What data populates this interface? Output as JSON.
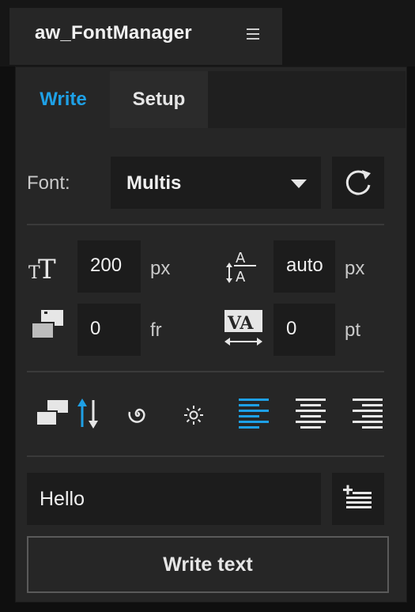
{
  "panel": {
    "title": "aw_FontManager"
  },
  "tabs": [
    {
      "label": "Write",
      "active": true
    },
    {
      "label": "Setup",
      "active": false
    }
  ],
  "font": {
    "label": "Font:",
    "value": "Multis"
  },
  "size": {
    "value": "200",
    "unit": "px"
  },
  "leading": {
    "value": "auto",
    "unit": "px"
  },
  "frames": {
    "value": "0",
    "unit": "fr"
  },
  "tracking": {
    "value": "0",
    "unit": "pt"
  },
  "toolbar": {
    "icons": [
      "layers-sort-icon",
      "spiral-icon",
      "sun-icon",
      "align-left-icon",
      "align-center-icon",
      "align-right-icon"
    ],
    "active_alignment": "left"
  },
  "text_input": {
    "value": "Hello"
  },
  "write_button": {
    "label": "Write text"
  },
  "colors": {
    "accent": "#1ea0e6",
    "panel": "#262626",
    "field": "#1c1c1c"
  }
}
